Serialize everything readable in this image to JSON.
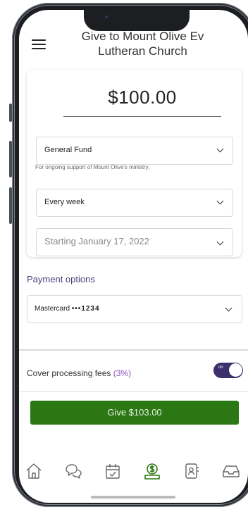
{
  "header": {
    "title": "Give to Mount Olive Ev Lutheran Church",
    "menu_icon": "hamburger-menu-icon"
  },
  "gift": {
    "amount": "$100.00",
    "fund": "General Fund",
    "fund_note": "For ongoing support of Mount Olive's ministry.",
    "frequency": "Every week",
    "start_date": "Starting January 17, 2022"
  },
  "payment": {
    "section_title": "Payment options",
    "card_brand": "Mastercard",
    "card_dots": "•••",
    "card_last4": "1234"
  },
  "fees": {
    "label": "Cover processing fees",
    "percent": "(3%)",
    "toggle_state": "on",
    "toggle_text": "on"
  },
  "give_button": {
    "label": "Give $103.00"
  },
  "colors": {
    "accent_purple": "#3d2f6d",
    "fee_percent": "#8e4fc3",
    "give_green": "#2a7714",
    "active_tab": "#2a7714"
  },
  "tabbar": {
    "items": [
      {
        "icon": "home-icon",
        "active": false
      },
      {
        "icon": "chat-bubbles-icon",
        "active": false
      },
      {
        "icon": "calendar-check-icon",
        "active": false
      },
      {
        "icon": "giving-dollar-icon",
        "active": true
      },
      {
        "icon": "contacts-icon",
        "active": false
      },
      {
        "icon": "inbox-tray-icon",
        "active": false
      }
    ]
  }
}
